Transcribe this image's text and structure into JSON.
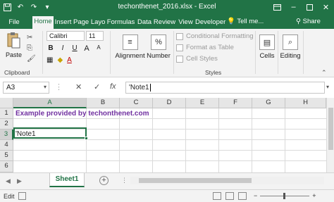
{
  "window": {
    "title": "techonthenet_2016.xlsx - Excel",
    "controls": [
      "restore-icon",
      "minimize-icon",
      "maximize-icon",
      "close-icon"
    ]
  },
  "quick_access": [
    "save-icon",
    "undo-icon",
    "redo-icon",
    "customize-icon"
  ],
  "tabs": [
    {
      "label": "File"
    },
    {
      "label": "Home"
    },
    {
      "label": "Insert"
    },
    {
      "label": "Page Layo"
    },
    {
      "label": "Formulas"
    },
    {
      "label": "Data"
    },
    {
      "label": "Review"
    },
    {
      "label": "View"
    },
    {
      "label": "Developer"
    }
  ],
  "active_tab": "Home",
  "tell_me": "Tell me...",
  "share": "Share",
  "ribbon": {
    "clipboard": {
      "paste": "Paste",
      "group_label": "Clipboard"
    },
    "font": {
      "name": "Calibri",
      "size": "11",
      "bold": "B",
      "italic": "I",
      "underline": "U",
      "grow": "A",
      "shrink": "A"
    },
    "alignment": {
      "label": "Alignment"
    },
    "number": {
      "label": "Number"
    },
    "styles": {
      "conditional": "Conditional Formatting",
      "format_table": "Format as Table",
      "cell_styles": "Cell Styles",
      "group_label": "Styles"
    },
    "cells": {
      "label": "Cells"
    },
    "editing": {
      "label": "Editing"
    }
  },
  "formula_bar": {
    "name_box": "A3",
    "formula": "'Note1"
  },
  "sheet": {
    "columns": [
      "A",
      "B",
      "C",
      "D",
      "E",
      "F",
      "G",
      "H"
    ],
    "selected_column": "A",
    "rows": [
      "1",
      "2",
      "3",
      "4",
      "5",
      "6"
    ],
    "selected_row": "3",
    "cells": {
      "A1": "Example provided by techonthenet.com",
      "A3": "'Note1"
    }
  },
  "sheet_tabs": {
    "active": "Sheet1"
  },
  "status": {
    "mode": "Edit"
  },
  "colors": {
    "accent": "#217346",
    "note_text": "#7030a0"
  }
}
